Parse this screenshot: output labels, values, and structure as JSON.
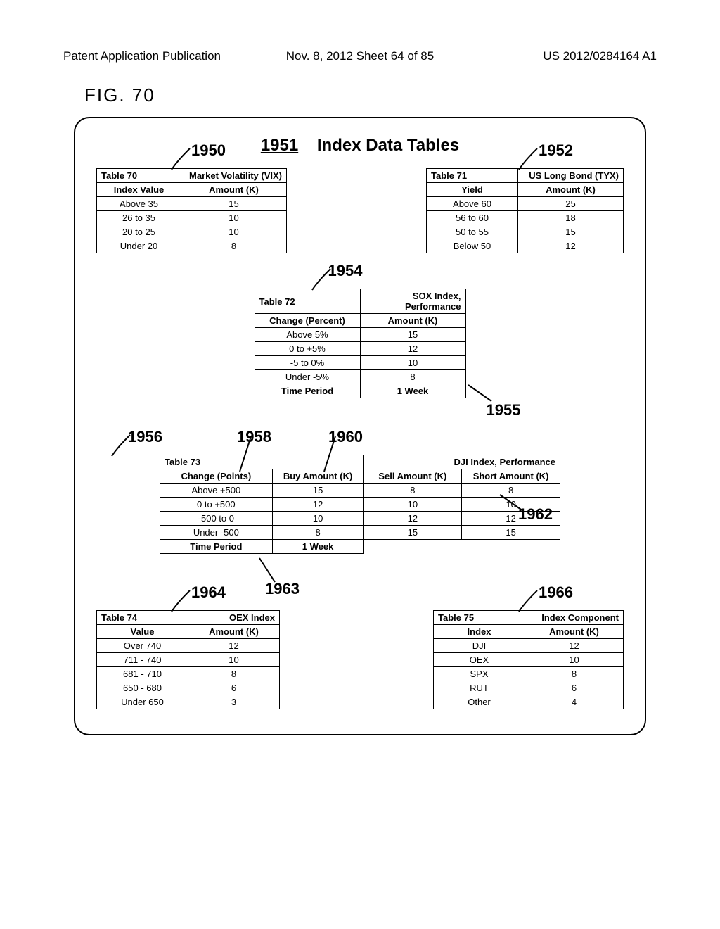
{
  "header": {
    "left": "Patent Application Publication",
    "mid": "Nov. 8, 2012  Sheet 64 of 85",
    "right": "US 2012/0284164 A1"
  },
  "fig_label": "FIG. 70",
  "title": {
    "num": "1951",
    "text": "Index Data Tables"
  },
  "refs": {
    "r1950": "1950",
    "r1952": "1952",
    "r1954": "1954",
    "r1955": "1955",
    "r1956": "1956",
    "r1958": "1958",
    "r1960": "1960",
    "r1962": "1962",
    "r1963": "1963",
    "r1964": "1964",
    "r1966": "1966"
  },
  "t70": {
    "id": "Table 70",
    "name": "Market Volatility (VIX)",
    "h1": "Index Value",
    "h2": "Amount (K)",
    "rows": [
      {
        "a": "Above 35",
        "b": "15"
      },
      {
        "a": "26 to 35",
        "b": "10"
      },
      {
        "a": "20 to 25",
        "b": "10"
      },
      {
        "a": "Under 20",
        "b": "8"
      }
    ]
  },
  "t71": {
    "id": "Table 71",
    "name": "US Long Bond (TYX)",
    "h1": "Yield",
    "h2": "Amount (K)",
    "rows": [
      {
        "a": "Above 60",
        "b": "25"
      },
      {
        "a": "56 to 60",
        "b": "18"
      },
      {
        "a": "50 to 55",
        "b": "15"
      },
      {
        "a": "Below 50",
        "b": "12"
      }
    ]
  },
  "t72": {
    "id": "Table 72",
    "name": "SOX Index, Performance",
    "h1": "Change (Percent)",
    "h2": "Amount (K)",
    "rows": [
      {
        "a": "Above 5%",
        "b": "15"
      },
      {
        "a": "0 to +5%",
        "b": "12"
      },
      {
        "a": "-5 to 0%",
        "b": "10"
      },
      {
        "a": "Under -5%",
        "b": "8"
      }
    ],
    "f1": "Time Period",
    "f2": "1 Week"
  },
  "t73": {
    "id": "Table 73",
    "name": "DJI Index, Performance",
    "h1": "Change (Points)",
    "h2": "Buy   Amount (K)",
    "h3": "Sell   Amount (K)",
    "h4": "Short Amount (K)",
    "rows": [
      {
        "a": "Above +500",
        "b": "15",
        "c": "8",
        "d": "8"
      },
      {
        "a": "0 to +500",
        "b": "12",
        "c": "10",
        "d": "10"
      },
      {
        "a": "-500 to 0",
        "b": "10",
        "c": "12",
        "d": "12"
      },
      {
        "a": "Under -500",
        "b": "8",
        "c": "15",
        "d": "15"
      }
    ],
    "f1": "Time Period",
    "f2": "1 Week"
  },
  "t74": {
    "id": "Table 74",
    "name": "OEX Index",
    "h1": "Value",
    "h2": "Amount (K)",
    "rows": [
      {
        "a": "Over 740",
        "b": "12"
      },
      {
        "a": "711 - 740",
        "b": "10"
      },
      {
        "a": "681 - 710",
        "b": "8"
      },
      {
        "a": "650 - 680",
        "b": "6"
      },
      {
        "a": "Under 650",
        "b": "3"
      }
    ]
  },
  "t75": {
    "id": "Table 75",
    "name": "Index Component",
    "h1": "Index",
    "h2": "Amount (K)",
    "rows": [
      {
        "a": "DJI",
        "b": "12"
      },
      {
        "a": "OEX",
        "b": "10"
      },
      {
        "a": "SPX",
        "b": "8"
      },
      {
        "a": "RUT",
        "b": "6"
      },
      {
        "a": "Other",
        "b": "4"
      }
    ]
  }
}
